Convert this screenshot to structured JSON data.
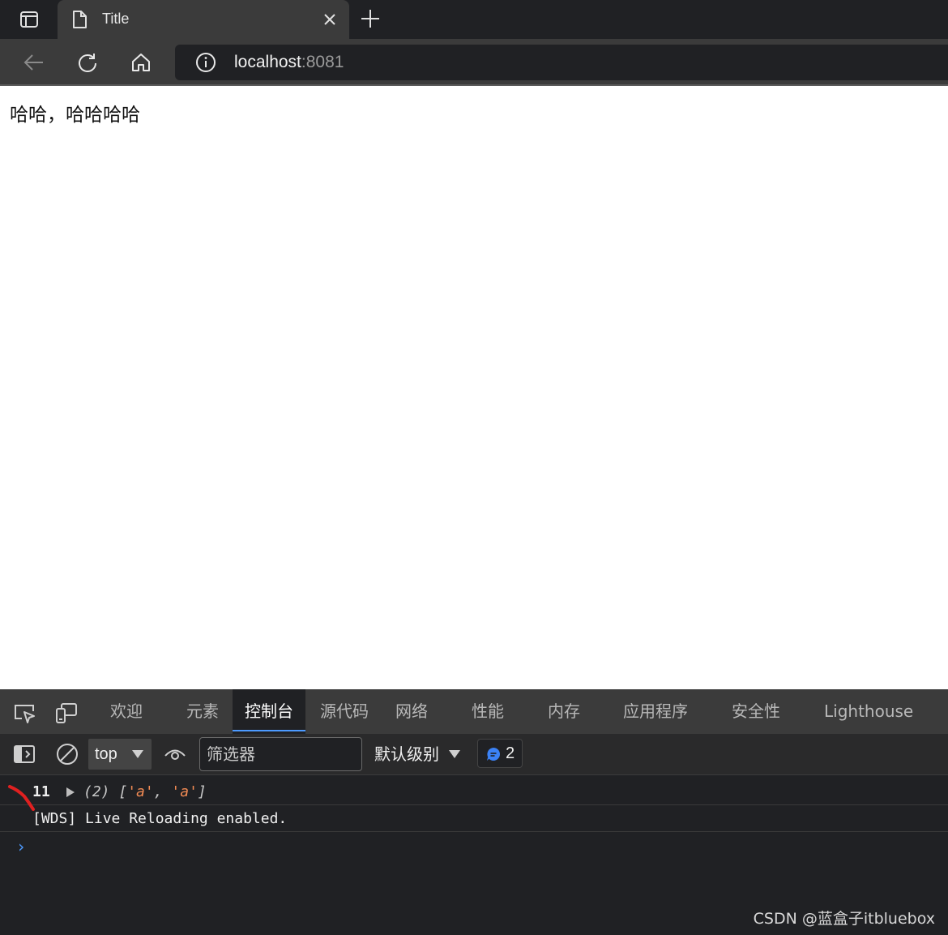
{
  "browser": {
    "tab": {
      "title": "Title"
    },
    "address": {
      "host": "localhost",
      "port": ":8081"
    }
  },
  "page": {
    "body_text": "哈哈，哈哈哈哈"
  },
  "devtools": {
    "tabs": [
      "欢迎",
      "元素",
      "控制台",
      "源代码",
      "网络",
      "性能",
      "内存",
      "应用程序",
      "安全性",
      "Lighthouse"
    ],
    "active_tab": "控制台",
    "toolbar": {
      "context": "top",
      "filter_placeholder": "筛选器",
      "levels": "默认级别",
      "issues_count": "2"
    },
    "console": {
      "logs": [
        {
          "num": "11",
          "array_len": "(2)",
          "items": [
            "'a'",
            "'a'"
          ]
        },
        {
          "text": "[WDS] Live Reloading enabled."
        }
      ],
      "prompt": "›"
    }
  },
  "watermark": "CSDN @蓝盒子itbluebox",
  "colors": {
    "accent": "#4c9aff",
    "string": "#f28b54",
    "devtools_bg": "#202124",
    "chrome_bg": "#3b3b3b"
  }
}
